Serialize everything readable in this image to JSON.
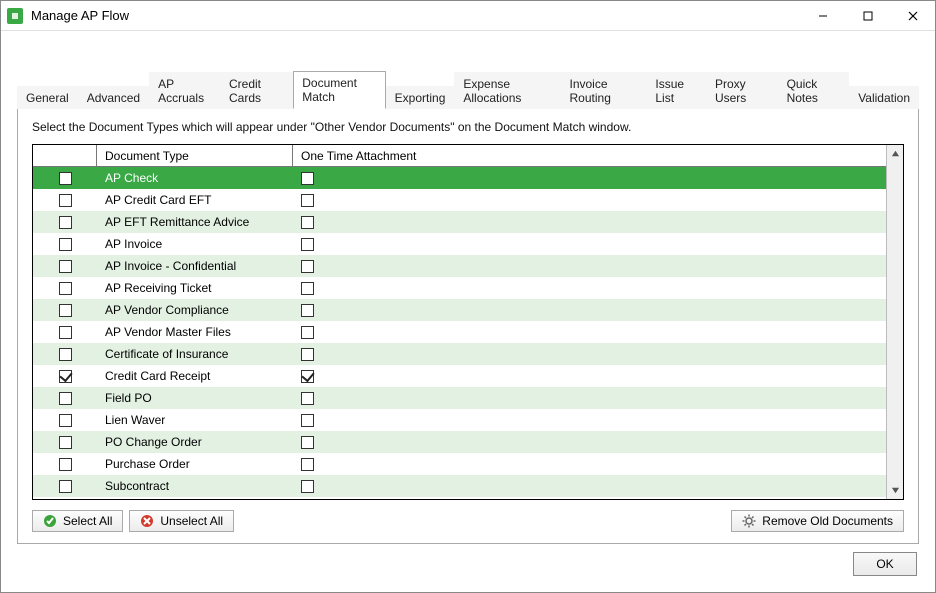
{
  "window": {
    "title": "Manage AP Flow"
  },
  "tabs": [
    {
      "label": "General"
    },
    {
      "label": "Advanced"
    },
    {
      "label": "AP Accruals"
    },
    {
      "label": "Credit Cards"
    },
    {
      "label": "Document Match"
    },
    {
      "label": "Exporting"
    },
    {
      "label": "Expense Allocations"
    },
    {
      "label": "Invoice Routing"
    },
    {
      "label": "Issue List"
    },
    {
      "label": "Proxy Users"
    },
    {
      "label": "Quick Notes"
    },
    {
      "label": "Validation"
    }
  ],
  "active_tab_index": 4,
  "panel": {
    "instruction": "Select the Document Types which will appear under \"Other Vendor Documents\" on the Document Match window.",
    "columns": {
      "doc_type": "Document Type",
      "one_time_attachment": "One Time Attachment"
    },
    "rows": [
      {
        "selected": false,
        "doc_type": "AP Check",
        "one_time": false,
        "highlight": true
      },
      {
        "selected": false,
        "doc_type": "AP Credit Card EFT",
        "one_time": false
      },
      {
        "selected": false,
        "doc_type": "AP EFT Remittance Advice",
        "one_time": false
      },
      {
        "selected": false,
        "doc_type": "AP Invoice",
        "one_time": false
      },
      {
        "selected": false,
        "doc_type": "AP Invoice - Confidential",
        "one_time": false
      },
      {
        "selected": false,
        "doc_type": "AP Receiving Ticket",
        "one_time": false
      },
      {
        "selected": false,
        "doc_type": "AP Vendor Compliance",
        "one_time": false
      },
      {
        "selected": false,
        "doc_type": "AP Vendor Master Files",
        "one_time": false
      },
      {
        "selected": false,
        "doc_type": "Certificate of Insurance",
        "one_time": false
      },
      {
        "selected": true,
        "doc_type": "Credit Card Receipt",
        "one_time": true
      },
      {
        "selected": false,
        "doc_type": "Field PO",
        "one_time": false
      },
      {
        "selected": false,
        "doc_type": "Lien Waver",
        "one_time": false
      },
      {
        "selected": false,
        "doc_type": "PO Change Order",
        "one_time": false
      },
      {
        "selected": false,
        "doc_type": "Purchase Order",
        "one_time": false
      },
      {
        "selected": false,
        "doc_type": "Subcontract",
        "one_time": false
      }
    ],
    "buttons": {
      "select_all": "Select All",
      "unselect_all": "Unselect All",
      "remove_old": "Remove Old Documents"
    }
  },
  "buttons": {
    "ok": "OK"
  }
}
